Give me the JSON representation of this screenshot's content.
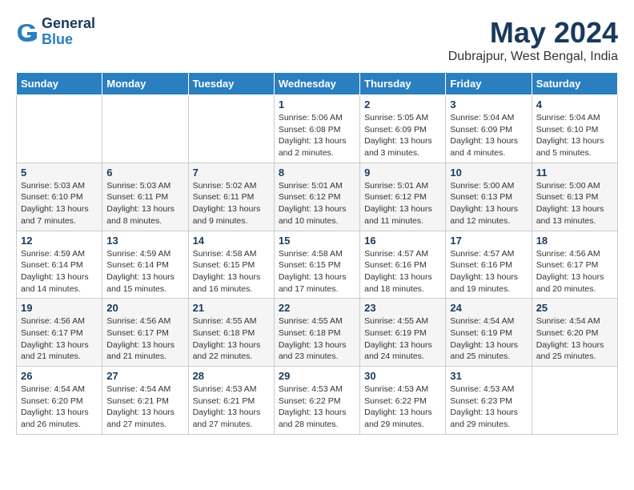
{
  "header": {
    "logo_line1": "General",
    "logo_line2": "Blue",
    "main_title": "May 2024",
    "subtitle": "Dubrajpur, West Bengal, India"
  },
  "calendar": {
    "weekdays": [
      "Sunday",
      "Monday",
      "Tuesday",
      "Wednesday",
      "Thursday",
      "Friday",
      "Saturday"
    ],
    "rows": [
      [
        {
          "day": "",
          "info": ""
        },
        {
          "day": "",
          "info": ""
        },
        {
          "day": "",
          "info": ""
        },
        {
          "day": "1",
          "info": "Sunrise: 5:06 AM\nSunset: 6:08 PM\nDaylight: 13 hours and 2 minutes."
        },
        {
          "day": "2",
          "info": "Sunrise: 5:05 AM\nSunset: 6:09 PM\nDaylight: 13 hours and 3 minutes."
        },
        {
          "day": "3",
          "info": "Sunrise: 5:04 AM\nSunset: 6:09 PM\nDaylight: 13 hours and 4 minutes."
        },
        {
          "day": "4",
          "info": "Sunrise: 5:04 AM\nSunset: 6:10 PM\nDaylight: 13 hours and 5 minutes."
        }
      ],
      [
        {
          "day": "5",
          "info": "Sunrise: 5:03 AM\nSunset: 6:10 PM\nDaylight: 13 hours and 7 minutes."
        },
        {
          "day": "6",
          "info": "Sunrise: 5:03 AM\nSunset: 6:11 PM\nDaylight: 13 hours and 8 minutes."
        },
        {
          "day": "7",
          "info": "Sunrise: 5:02 AM\nSunset: 6:11 PM\nDaylight: 13 hours and 9 minutes."
        },
        {
          "day": "8",
          "info": "Sunrise: 5:01 AM\nSunset: 6:12 PM\nDaylight: 13 hours and 10 minutes."
        },
        {
          "day": "9",
          "info": "Sunrise: 5:01 AM\nSunset: 6:12 PM\nDaylight: 13 hours and 11 minutes."
        },
        {
          "day": "10",
          "info": "Sunrise: 5:00 AM\nSunset: 6:13 PM\nDaylight: 13 hours and 12 minutes."
        },
        {
          "day": "11",
          "info": "Sunrise: 5:00 AM\nSunset: 6:13 PM\nDaylight: 13 hours and 13 minutes."
        }
      ],
      [
        {
          "day": "12",
          "info": "Sunrise: 4:59 AM\nSunset: 6:14 PM\nDaylight: 13 hours and 14 minutes."
        },
        {
          "day": "13",
          "info": "Sunrise: 4:59 AM\nSunset: 6:14 PM\nDaylight: 13 hours and 15 minutes."
        },
        {
          "day": "14",
          "info": "Sunrise: 4:58 AM\nSunset: 6:15 PM\nDaylight: 13 hours and 16 minutes."
        },
        {
          "day": "15",
          "info": "Sunrise: 4:58 AM\nSunset: 6:15 PM\nDaylight: 13 hours and 17 minutes."
        },
        {
          "day": "16",
          "info": "Sunrise: 4:57 AM\nSunset: 6:16 PM\nDaylight: 13 hours and 18 minutes."
        },
        {
          "day": "17",
          "info": "Sunrise: 4:57 AM\nSunset: 6:16 PM\nDaylight: 13 hours and 19 minutes."
        },
        {
          "day": "18",
          "info": "Sunrise: 4:56 AM\nSunset: 6:17 PM\nDaylight: 13 hours and 20 minutes."
        }
      ],
      [
        {
          "day": "19",
          "info": "Sunrise: 4:56 AM\nSunset: 6:17 PM\nDaylight: 13 hours and 21 minutes."
        },
        {
          "day": "20",
          "info": "Sunrise: 4:56 AM\nSunset: 6:17 PM\nDaylight: 13 hours and 21 minutes."
        },
        {
          "day": "21",
          "info": "Sunrise: 4:55 AM\nSunset: 6:18 PM\nDaylight: 13 hours and 22 minutes."
        },
        {
          "day": "22",
          "info": "Sunrise: 4:55 AM\nSunset: 6:18 PM\nDaylight: 13 hours and 23 minutes."
        },
        {
          "day": "23",
          "info": "Sunrise: 4:55 AM\nSunset: 6:19 PM\nDaylight: 13 hours and 24 minutes."
        },
        {
          "day": "24",
          "info": "Sunrise: 4:54 AM\nSunset: 6:19 PM\nDaylight: 13 hours and 25 minutes."
        },
        {
          "day": "25",
          "info": "Sunrise: 4:54 AM\nSunset: 6:20 PM\nDaylight: 13 hours and 25 minutes."
        }
      ],
      [
        {
          "day": "26",
          "info": "Sunrise: 4:54 AM\nSunset: 6:20 PM\nDaylight: 13 hours and 26 minutes."
        },
        {
          "day": "27",
          "info": "Sunrise: 4:54 AM\nSunset: 6:21 PM\nDaylight: 13 hours and 27 minutes."
        },
        {
          "day": "28",
          "info": "Sunrise: 4:53 AM\nSunset: 6:21 PM\nDaylight: 13 hours and 27 minutes."
        },
        {
          "day": "29",
          "info": "Sunrise: 4:53 AM\nSunset: 6:22 PM\nDaylight: 13 hours and 28 minutes."
        },
        {
          "day": "30",
          "info": "Sunrise: 4:53 AM\nSunset: 6:22 PM\nDaylight: 13 hours and 29 minutes."
        },
        {
          "day": "31",
          "info": "Sunrise: 4:53 AM\nSunset: 6:23 PM\nDaylight: 13 hours and 29 minutes."
        },
        {
          "day": "",
          "info": ""
        }
      ]
    ]
  }
}
